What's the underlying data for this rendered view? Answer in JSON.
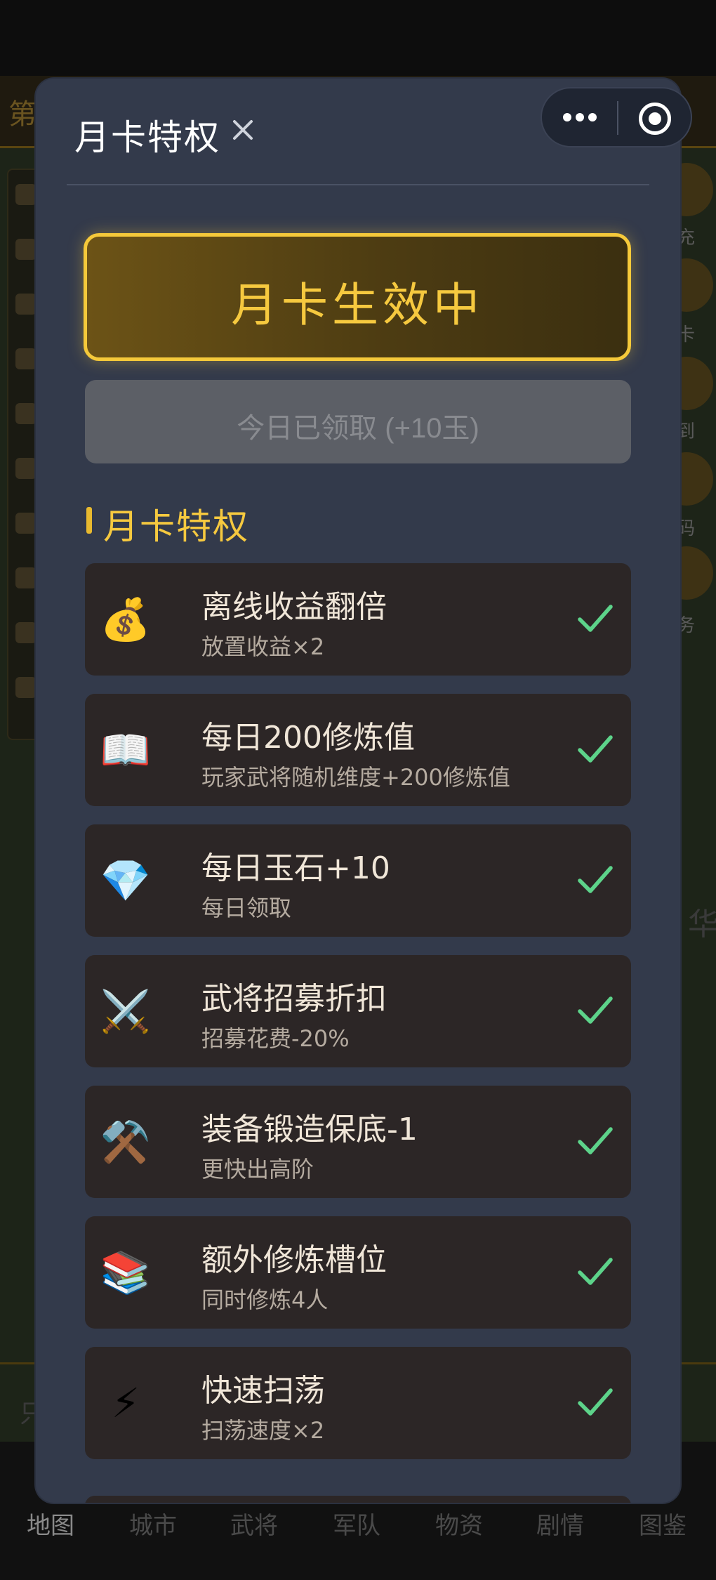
{
  "background": {
    "topbar_text": "第",
    "right_labels": [
      "充",
      "卡",
      "到",
      "码",
      "务"
    ],
    "tabs": [
      "地图",
      "城市",
      "武将",
      "军队",
      "物资",
      "剧情",
      "图鉴"
    ],
    "faint_chars": [
      "华",
      "只"
    ]
  },
  "capsule": {
    "more_icon": "more-dots-icon",
    "close_icon": "target-close-icon"
  },
  "modal": {
    "title": "月卡特权",
    "close_icon": "close-icon",
    "status_text": "月卡生效中",
    "claim_label": "今日已领取 (+10玉)",
    "section_title": "月卡特权",
    "perks": [
      {
        "icon": "money-bag-icon",
        "emoji": "💰",
        "title": "离线收益翻倍",
        "desc": "放置收益×2",
        "done": true
      },
      {
        "icon": "open-book-icon",
        "emoji": "📖",
        "title": "每日200修炼值",
        "desc": "玩家武将随机维度+200修炼值",
        "done": true
      },
      {
        "icon": "gem-icon",
        "emoji": "💎",
        "title": "每日玉石+10",
        "desc": "每日领取",
        "done": true
      },
      {
        "icon": "crossed-swords-icon",
        "emoji": "⚔️",
        "title": "武将招募折扣",
        "desc": "招募花费-20%",
        "done": true
      },
      {
        "icon": "hammer-pick-icon",
        "emoji": "⚒️",
        "title": "装备锻造保底-1",
        "desc": "更快出高阶",
        "done": true
      },
      {
        "icon": "books-icon",
        "emoji": "📚",
        "title": "额外修炼槽位",
        "desc": "同时修炼4人",
        "done": true
      },
      {
        "icon": "lightning-icon",
        "emoji": "⚡",
        "title": "快速扫荡",
        "desc": "扫荡速度×2",
        "done": true
      }
    ]
  },
  "colors": {
    "accent_gold": "#f6c93f",
    "check_green": "#5dd38a",
    "modal_bg": "#333a4b",
    "card_bg": "#2c2626"
  }
}
